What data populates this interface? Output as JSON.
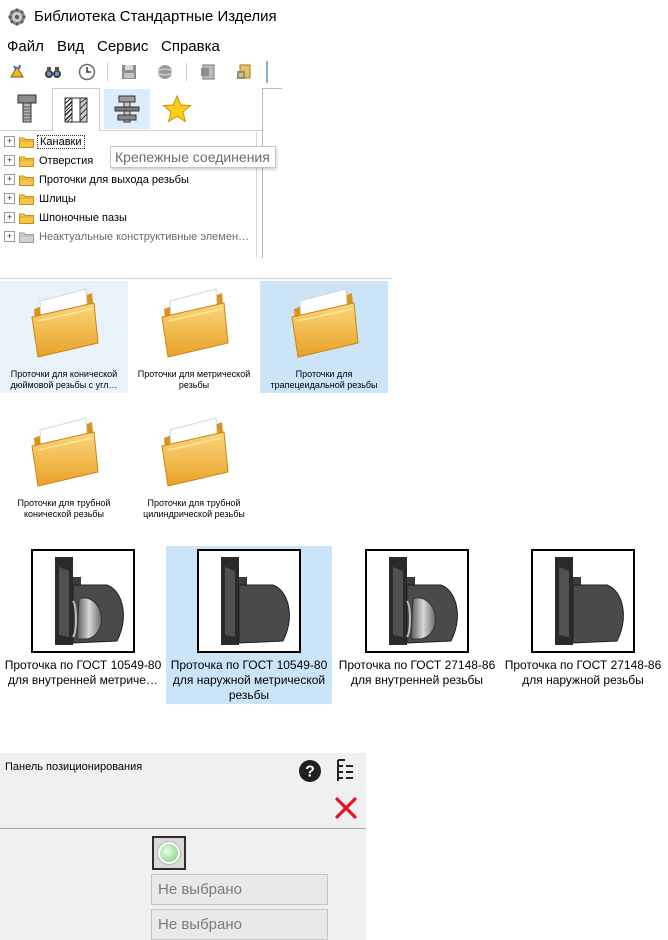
{
  "window": {
    "title": "Библиотека Стандартные Изделия"
  },
  "menu": [
    "Файл",
    "Вид",
    "Сервис",
    "Справка"
  ],
  "toolbar": {
    "icons": [
      "library-icon",
      "binoculars-icon",
      "clock-icon",
      "save-icon",
      "sphere-icon",
      "document-icon",
      "document-lock-icon"
    ]
  },
  "tabs": [
    "bolt-tab",
    "nut-section-tab",
    "fastener-assembly-tab",
    "favorites-tab"
  ],
  "tree": {
    "items": [
      {
        "label": "Канавки",
        "state": "selected"
      },
      {
        "label": "Отверстия",
        "state": "normal"
      },
      {
        "label": "Проточки для выхода резьбы",
        "state": "normal"
      },
      {
        "label": "Шлицы",
        "state": "normal"
      },
      {
        "label": "Шпоночные пазы",
        "state": "normal"
      },
      {
        "label": "Неактуальные конструктивные элемен…",
        "state": "muted"
      }
    ],
    "tooltip": "Крепежные соединения"
  },
  "folders": [
    {
      "line1": "Проточки для конической",
      "line2": "дюймовой резьбы с угл…",
      "state": "hover"
    },
    {
      "line1": "Проточки для метрической",
      "line2": "резьбы",
      "state": "normal"
    },
    {
      "line1": "Проточки для",
      "line2": "трапецеидальной резьбы",
      "state": "selected"
    },
    {
      "line1": "Проточки для трубной",
      "line2": "конической резьбы",
      "state": "normal"
    },
    {
      "line1": "Проточки для трубной",
      "line2": "цилиндрической резьбы",
      "state": "normal"
    }
  ],
  "models": [
    {
      "line1": "Проточка по ГОСТ 10549-80",
      "line2": "для внутренней метриче…",
      "line3": "",
      "state": "normal"
    },
    {
      "line1": "Проточка по ГОСТ 10549-80",
      "line2": "для наружной метрической",
      "line3": "резьбы",
      "state": "selected"
    },
    {
      "line1": "Проточка по ГОСТ 27148-86",
      "line2": "для внутренней резьбы",
      "line3": "",
      "state": "normal"
    },
    {
      "line1": "Проточка по ГОСТ 27148-86",
      "line2": "для наружной резьбы",
      "line3": "",
      "state": "normal"
    }
  ],
  "positioning": {
    "title": "Панель позиционирования",
    "field1": "Не выбрано",
    "field2": "Не выбрано",
    "close_color": "#e81123"
  },
  "colors": {
    "selection": "#cce4f7",
    "hover": "#e9f3fc",
    "folder": "#f5b73a"
  }
}
